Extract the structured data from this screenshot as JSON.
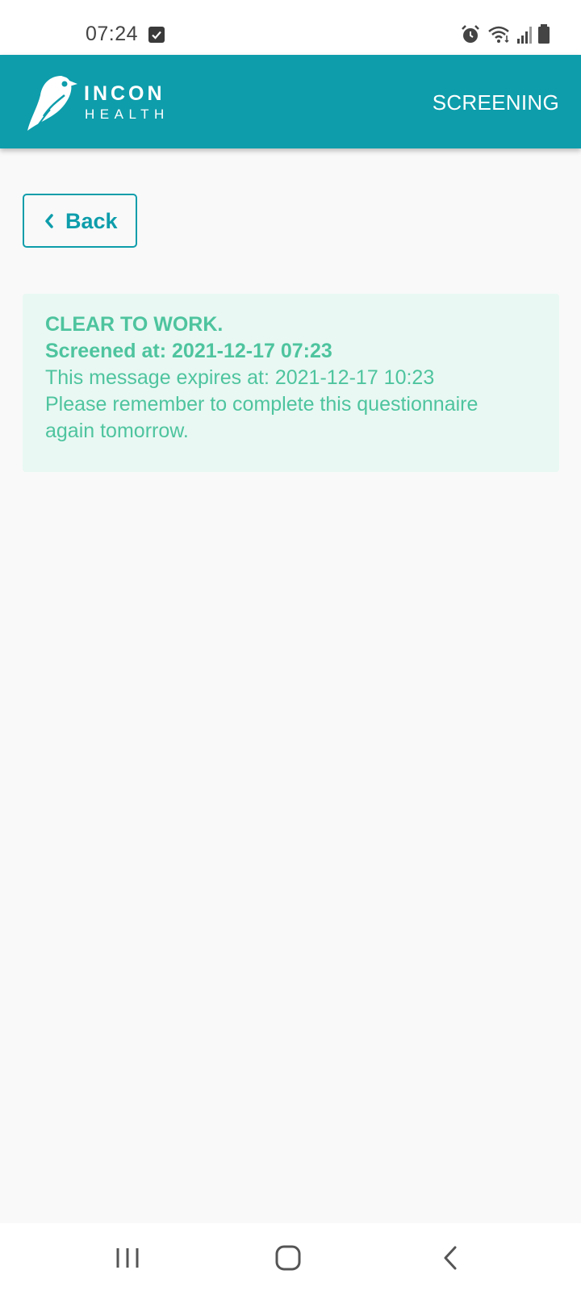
{
  "status_bar": {
    "time": "07:24",
    "icons": [
      "checkbox-notification-icon",
      "alarm-icon",
      "wifi-icon",
      "signal-icon",
      "battery-icon"
    ]
  },
  "app_bar": {
    "logo_line1": "INCON",
    "logo_line2": "HEALTH",
    "title": "SCREENING",
    "color": "#0e9dab"
  },
  "back_button": {
    "label": "Back",
    "icon": "chevron-left-icon"
  },
  "alert": {
    "status": "CLEAR TO WORK.",
    "screened_at": "Screened at: 2021-12-17 07:23",
    "expires": "This message expires at: 2021-12-17 10:23",
    "reminder_line1": "Please remember to complete this questionnaire",
    "reminder_line2": "again tomorrow.",
    "background": "#e9f8f3",
    "text_color": "#4ec49e"
  },
  "nav_bar": {
    "buttons": [
      "recent-apps-icon",
      "home-icon",
      "back-icon"
    ]
  }
}
